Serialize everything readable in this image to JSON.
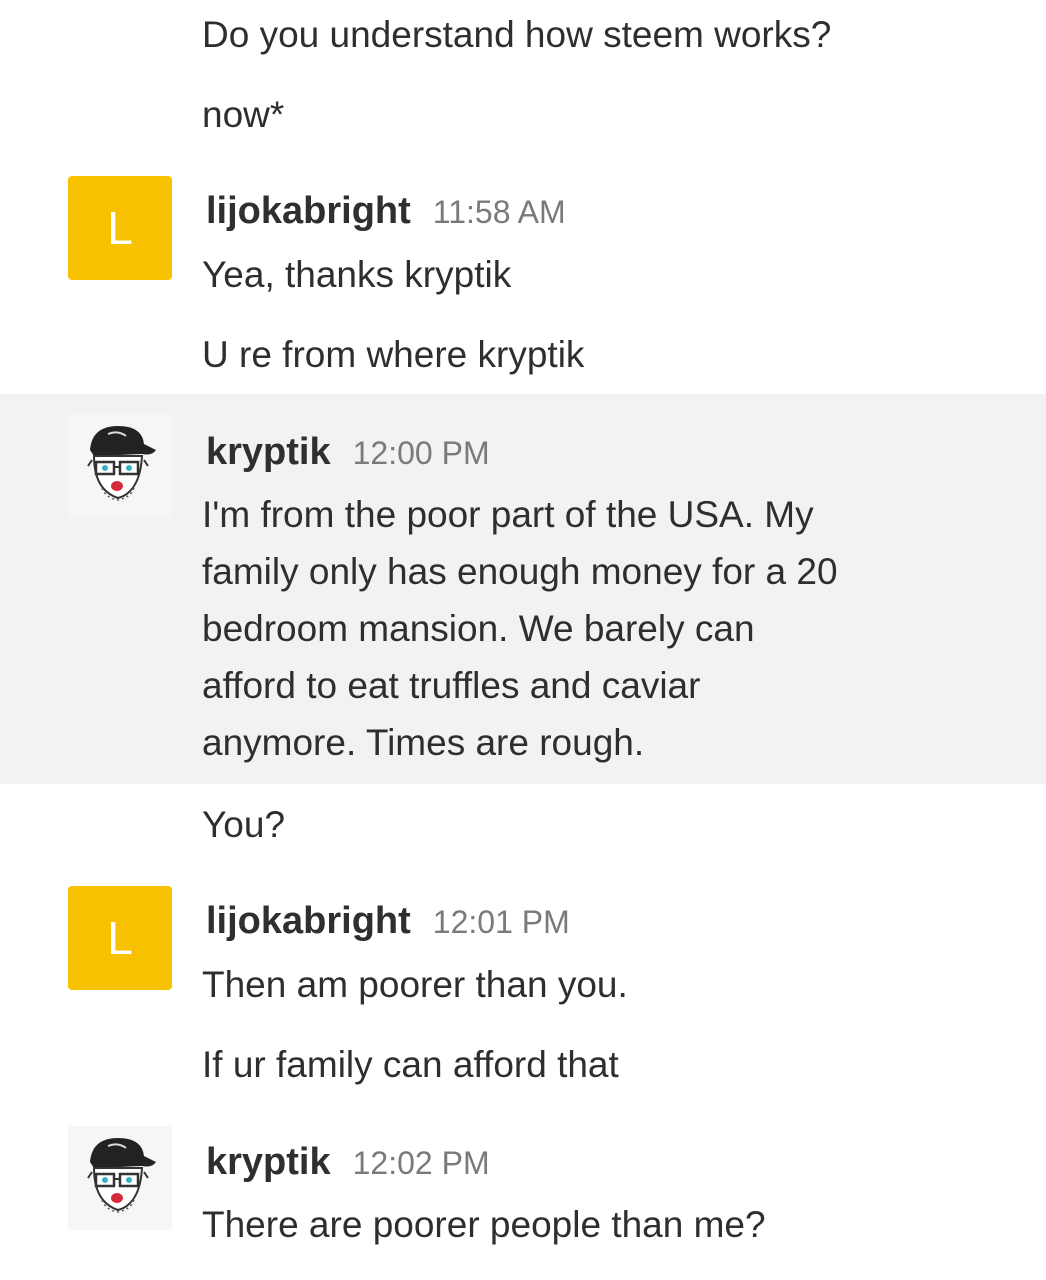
{
  "messages": [
    {
      "type": "continuation",
      "text": "Do you understand how steem works?"
    },
    {
      "type": "continuation",
      "text": "now*"
    },
    {
      "type": "group",
      "author": "lijokabright",
      "avatar": {
        "kind": "letter",
        "letter": "L",
        "color": "#f7c100"
      },
      "time": "11:58 AM",
      "lines": [
        "Yea, thanks kryptik"
      ]
    },
    {
      "type": "continuation",
      "text": "U re from where kryptik"
    },
    {
      "type": "group",
      "author": "kryptik",
      "avatar": {
        "kind": "photo",
        "icon": "cartoon-face-avatar-icon"
      },
      "time": "12:00 PM",
      "highlighted": true,
      "lines": [
        "I'm from the poor part of the USA. My",
        "family only has enough money for a 20",
        "bedroom mansion. We barely can",
        "afford to eat truffles and caviar",
        "anymore. Times are rough."
      ]
    },
    {
      "type": "continuation",
      "text": "You?"
    },
    {
      "type": "group",
      "author": "lijokabright",
      "avatar": {
        "kind": "letter",
        "letter": "L",
        "color": "#f7c100"
      },
      "time": "12:01 PM",
      "lines": [
        "Then am poorer than you."
      ]
    },
    {
      "type": "continuation",
      "text": "If ur family can afford that"
    },
    {
      "type": "group",
      "author": "kryptik",
      "avatar": {
        "kind": "photo",
        "icon": "cartoon-face-avatar-icon"
      },
      "time": "12:02 PM",
      "lines": [
        "There are poorer people than me?"
      ]
    }
  ]
}
